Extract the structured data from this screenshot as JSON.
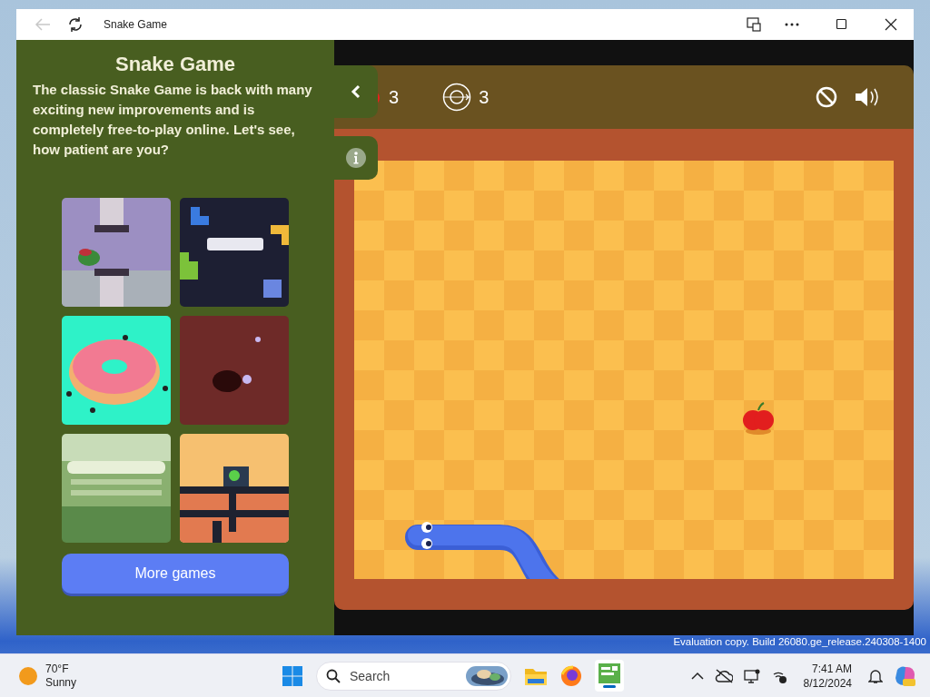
{
  "window": {
    "title": "Snake Game"
  },
  "sidebar": {
    "title": "Snake Game",
    "description": "The classic Snake Game is back with many exciting new improvements and is completely free-to-play online. Let's see, how patient are you?",
    "more_button": "More games"
  },
  "game": {
    "apples": "3",
    "targets": "3"
  },
  "desktop": {
    "build_text": "Evaluation copy. Build 26080.ge_release.240308-1400"
  },
  "taskbar": {
    "weather": {
      "temperature": "70°F",
      "condition": "Sunny"
    },
    "search": {
      "placeholder": "Search"
    },
    "time": "7:41 AM",
    "date": "8/12/2024"
  }
}
